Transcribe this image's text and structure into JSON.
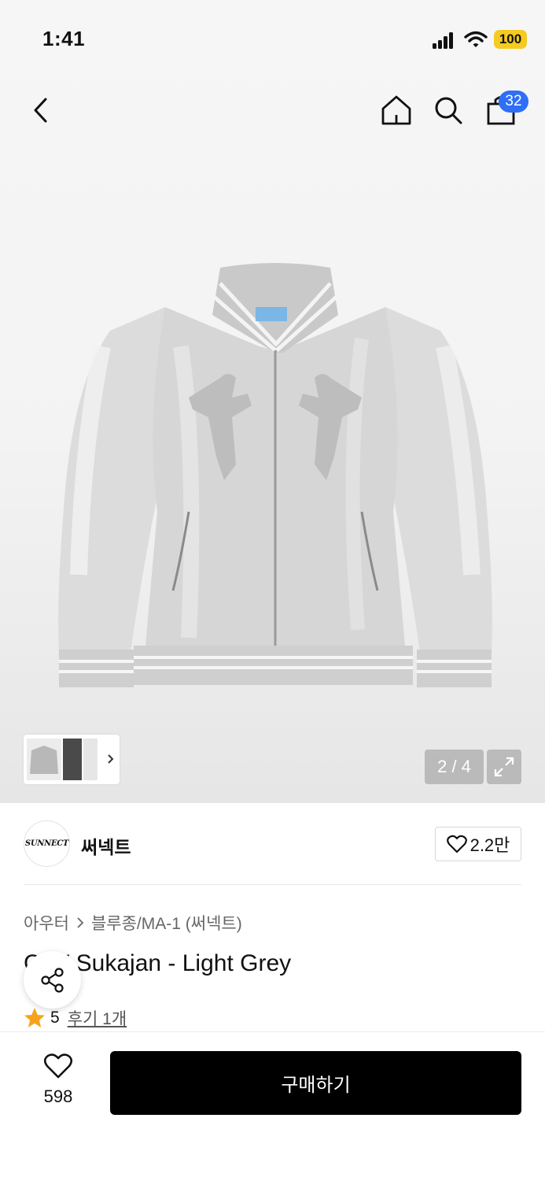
{
  "status_bar": {
    "time": "1:41",
    "battery": "100"
  },
  "nav": {
    "cart_count": "32",
    "icons": [
      "back-icon",
      "home-icon",
      "search-icon",
      "cart-icon"
    ]
  },
  "gallery": {
    "page_indicator": "2 / 4"
  },
  "brand": {
    "logo_text": "SUNNECT",
    "name": "써넥트",
    "like_count": "2.2만"
  },
  "breadcrumb": {
    "category": "아우터",
    "subcategory": "블루종/MA-1 (써넥트)"
  },
  "product": {
    "title": "C  W Sukajan - Light Grey",
    "rating": "5",
    "review_link": "후기 1개"
  },
  "bottom_bar": {
    "wish_count": "598",
    "buy_label": "구매하기"
  },
  "colors": {
    "accent_badge": "#2f6ff6",
    "battery": "#f4cb20",
    "star": "#f7a21b",
    "buy_button": "#000000"
  }
}
